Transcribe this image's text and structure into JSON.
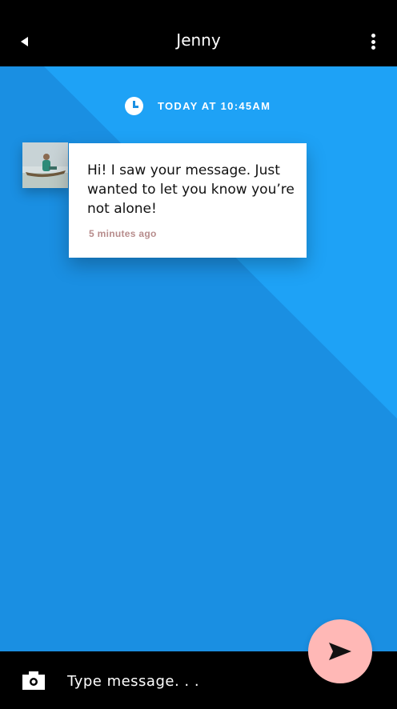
{
  "header": {
    "title": "Jenny",
    "back_icon": "back-arrow-icon",
    "more_icon": "more-vertical-icon"
  },
  "conversation": {
    "timestamp": "TODAY AT 10:45AM",
    "timestamp_icon": "clock-icon",
    "messages": [
      {
        "sender": "Jenny",
        "text": "Hi! I saw your message. Just wanted to let you know you’re not alone!",
        "time_ago": "5 minutes ago"
      }
    ]
  },
  "composer": {
    "placeholder": "Type message. . .",
    "camera_icon": "camera-icon",
    "send_icon": "send-icon"
  },
  "colors": {
    "header_bg": "#000000",
    "main_bg": "#1a8fe2",
    "main_bg_light": "#1ea2f6",
    "send_button": "#ffb8b6",
    "time_ago_text": "#b78c8c"
  }
}
